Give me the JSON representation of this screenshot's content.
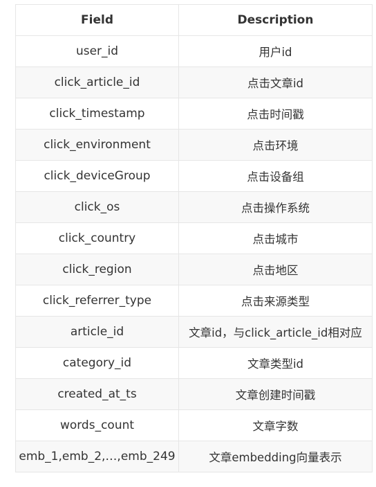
{
  "table": {
    "headers": [
      "Field",
      "Description"
    ],
    "rows": [
      {
        "field": "user_id",
        "description": "用户id"
      },
      {
        "field": "click_article_id",
        "description": "点击文章id"
      },
      {
        "field": "click_timestamp",
        "description": "点击时间戳"
      },
      {
        "field": "click_environment",
        "description": "点击环境"
      },
      {
        "field": "click_deviceGroup",
        "description": "点击设备组"
      },
      {
        "field": "click_os",
        "description": "点击操作系统"
      },
      {
        "field": "click_country",
        "description": "点击城市"
      },
      {
        "field": "click_region",
        "description": "点击地区"
      },
      {
        "field": "click_referrer_type",
        "description": "点击来源类型"
      },
      {
        "field": "article_id",
        "description": "文章id，与click_article_id相对应"
      },
      {
        "field": "category_id",
        "description": "文章类型id"
      },
      {
        "field": "created_at_ts",
        "description": "文章创建时间戳"
      },
      {
        "field": "words_count",
        "description": "文章字数"
      },
      {
        "field": "emb_1,emb_2,…,emb_249",
        "description": "文章embedding向量表示"
      }
    ]
  }
}
